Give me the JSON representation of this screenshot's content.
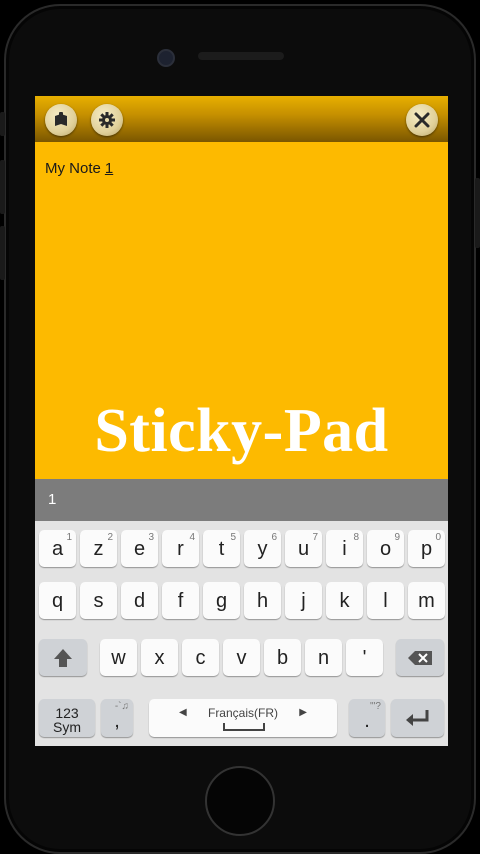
{
  "toolbar": {
    "icons": [
      "notepad-icon",
      "gear-icon"
    ],
    "close_icon": "close-icon"
  },
  "note": {
    "prefix": "My Note",
    "number": "1"
  },
  "brand": "Sticky-Pad",
  "suggestion": "1",
  "keyboard": {
    "row1": [
      {
        "label": "a",
        "hint": "1"
      },
      {
        "label": "z",
        "hint": "2"
      },
      {
        "label": "e",
        "hint": "3"
      },
      {
        "label": "r",
        "hint": "4"
      },
      {
        "label": "t",
        "hint": "5"
      },
      {
        "label": "y",
        "hint": "6"
      },
      {
        "label": "u",
        "hint": "7"
      },
      {
        "label": "i",
        "hint": "8"
      },
      {
        "label": "o",
        "hint": "9"
      },
      {
        "label": "p",
        "hint": "0"
      }
    ],
    "row2": [
      "q",
      "s",
      "d",
      "f",
      "g",
      "h",
      "j",
      "k",
      "l",
      "m"
    ],
    "row3": [
      "w",
      "x",
      "c",
      "v",
      "b",
      "n",
      "'"
    ],
    "sym_label_top": "123",
    "sym_label_bottom": "Sym",
    "comma": ",",
    "comma_hint": "-`♫",
    "space_label": "Français(FR)",
    "period": ".",
    "period_hint": "\"'?",
    "enter_icon": "enter-icon",
    "backspace_icon": "backspace-icon",
    "shift_icon": "shift-icon"
  }
}
